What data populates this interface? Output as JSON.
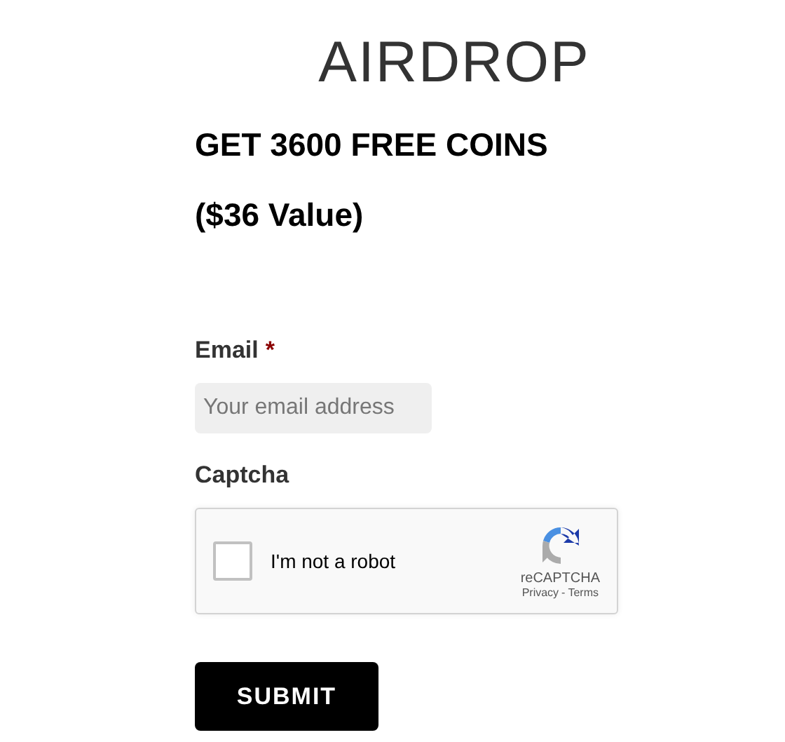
{
  "title": "AIRDROP",
  "headlines": [
    "GET 3600 FREE COINS",
    "($36 Value)"
  ],
  "fields": [
    {
      "kind": "email",
      "label": "Email",
      "required_mark": "*",
      "placeholder": "Your email address"
    },
    {
      "kind": "captcha",
      "label": "Captcha",
      "checked": false,
      "checkbox_label": "I'm not a robot",
      "brand": "reCAPTCHA",
      "links": [
        "Privacy",
        "Terms"
      ],
      "separator": "-"
    }
  ],
  "submit": "SUBMIT"
}
